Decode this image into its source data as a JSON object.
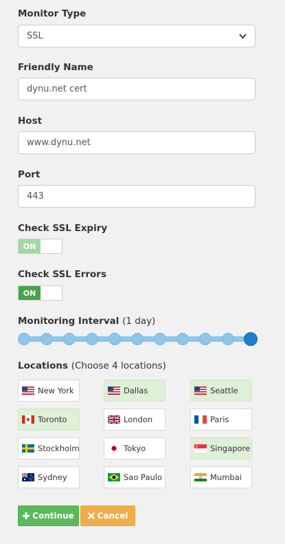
{
  "monitor_type": {
    "label": "Monitor Type",
    "value": "SSL"
  },
  "friendly_name": {
    "label": "Friendly Name",
    "value": "dynu.net cert"
  },
  "host": {
    "label": "Host",
    "value": "www.dynu.net"
  },
  "port": {
    "label": "Port",
    "value": "443"
  },
  "check_ssl_expiry": {
    "label": "Check SSL Expiry",
    "state": "ON",
    "enabled": true
  },
  "check_ssl_errors": {
    "label": "Check SSL Errors",
    "state": "ON",
    "enabled": true
  },
  "monitoring_interval": {
    "label": "Monitoring Interval",
    "value_text": "(1 day)",
    "steps": 11,
    "selected_step": 11
  },
  "locations": {
    "label": "Locations",
    "hint": "(Choose 4 locations)",
    "items": [
      {
        "name": "New York",
        "flag": "us-flag-icon",
        "selected": false
      },
      {
        "name": "Dallas",
        "flag": "us-flag-icon",
        "selected": true
      },
      {
        "name": "Seattle",
        "flag": "us-flag-icon",
        "selected": true
      },
      {
        "name": "Toronto",
        "flag": "canada-flag-icon",
        "selected": true
      },
      {
        "name": "London",
        "flag": "uk-flag-icon",
        "selected": false
      },
      {
        "name": "Paris",
        "flag": "france-flag-icon",
        "selected": false
      },
      {
        "name": "Stockholm",
        "flag": "sweden-flag-icon",
        "selected": false
      },
      {
        "name": "Tokyo",
        "flag": "japan-flag-icon",
        "selected": false
      },
      {
        "name": "Singapore",
        "flag": "singapore-flag-icon",
        "selected": true
      },
      {
        "name": "Sydney",
        "flag": "australia-flag-icon",
        "selected": false
      },
      {
        "name": "Sao Paulo",
        "flag": "brazil-flag-icon",
        "selected": false
      },
      {
        "name": "Mumbai",
        "flag": "india-flag-icon",
        "selected": false
      }
    ]
  },
  "actions": {
    "continue_label": "Continue",
    "cancel_label": "Cancel"
  },
  "colors": {
    "selected_location_bg": "#dff0d8",
    "toggle_on": "#47a447",
    "slider_track": "#8ec7ea",
    "slider_active": "#1e7fc6",
    "continue_button": "#5cb85c",
    "cancel_button": "#f0ad4e"
  }
}
